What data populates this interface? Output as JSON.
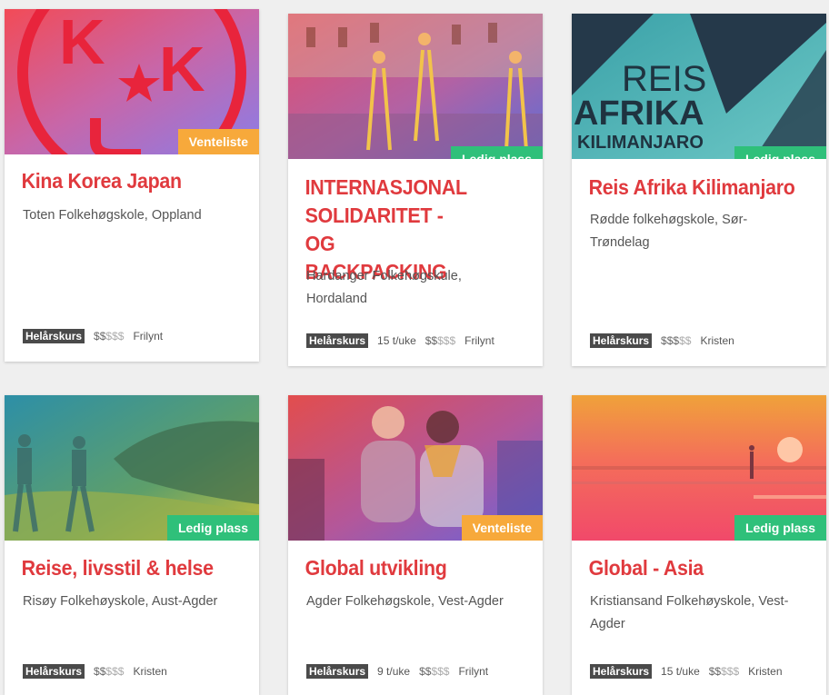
{
  "cards": [
    {
      "title": "Kina Korea Japan",
      "school": "Toten Folkehøgskole, Oppland",
      "badge": "Venteliste",
      "type": "Helårskurs",
      "hours": "",
      "price_on": "$$",
      "price_off": "$$$",
      "profile": "Frilynt"
    },
    {
      "title": "INTERNASJONAL SOLIDARITET - OG BACKPACKING",
      "school": "Hardanger Folkehøgskule, Hordaland",
      "badge": "Ledig plass",
      "type": "Helårskurs",
      "hours": "15 t/uke",
      "price_on": "$$",
      "price_off": "$$$",
      "profile": "Frilynt"
    },
    {
      "title": "Reis Afrika Kilimanjaro",
      "school": "Rødde folkehøgskole, Sør-Trøndelag",
      "badge": "Ledig plass",
      "type": "Helårskurs",
      "hours": "",
      "price_on": "$$$",
      "price_off": "$$",
      "profile": "Kristen",
      "image_text": [
        "REIS",
        "AFRIKA",
        "KILIMANJARO"
      ]
    },
    {
      "title": "Reise, livsstil & helse",
      "school": "Risøy Folkehøyskole, Aust-Agder",
      "badge": "Ledig plass",
      "type": "Helårskurs",
      "hours": "",
      "price_on": "$$",
      "price_off": "$$$",
      "profile": "Kristen"
    },
    {
      "title": "Global utvikling",
      "school": "Agder Folkehøgskole, Vest-Agder",
      "badge": "Venteliste",
      "type": "Helårskurs",
      "hours": "9 t/uke",
      "price_on": "$$",
      "price_off": "$$$",
      "profile": "Frilynt"
    },
    {
      "title": "Global - Asia",
      "school": "Kristiansand Folkehøyskole, Vest-Agder",
      "badge": "Ledig plass",
      "type": "Helårskurs",
      "hours": "15 t/uke",
      "price_on": "$$",
      "price_off": "$$$",
      "profile": "Kristen"
    }
  ],
  "colors": {
    "title_red": "#e03a3e",
    "venteliste": "#f7a93b",
    "ledig_plass": "#2fc07a",
    "type_tag": "#4a4a4a"
  }
}
